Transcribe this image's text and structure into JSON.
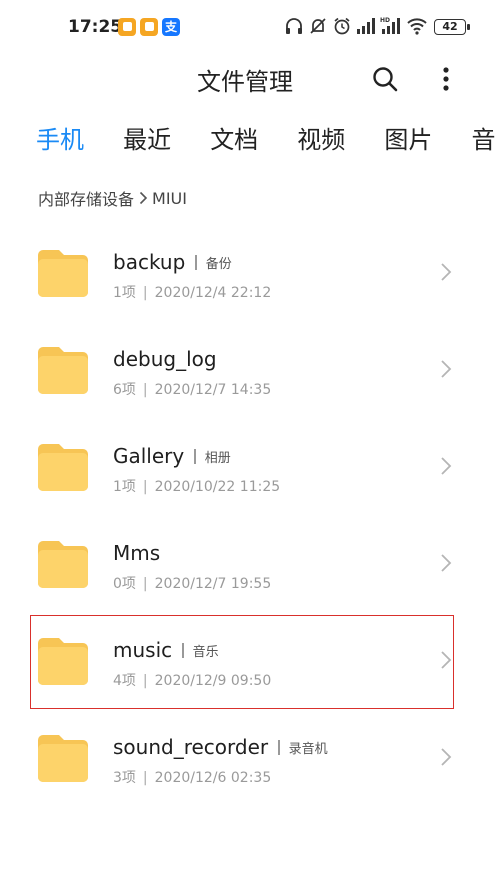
{
  "status_bar": {
    "time": "17:25",
    "notifications": [
      {
        "icon": "orange-app-icon",
        "color": "#f5a623"
      },
      {
        "icon": "orange-app-icon",
        "color": "#f5a623"
      },
      {
        "icon": "alipay-icon",
        "color": "#1677ff",
        "glyph": "支"
      }
    ],
    "battery": "42",
    "icons": [
      "headphones-icon",
      "vibrate-icon",
      "alarm-icon",
      "signal-icon",
      "signal-hd-icon",
      "wifi-icon"
    ]
  },
  "header": {
    "title": "文件管理"
  },
  "tabs": [
    {
      "label": "手机",
      "active": true
    },
    {
      "label": "最近",
      "active": false
    },
    {
      "label": "文档",
      "active": false
    },
    {
      "label": "视频",
      "active": false
    },
    {
      "label": "图片",
      "active": false
    },
    {
      "label": "音",
      "active": false
    }
  ],
  "breadcrumb": {
    "root": "内部存储设备",
    "current": "MIUI"
  },
  "folders": [
    {
      "name": "backup",
      "alias": "备份",
      "count": "1项",
      "date": "2020/12/4 22:12"
    },
    {
      "name": "debug_log",
      "alias": "",
      "count": "6项",
      "date": "2020/12/7 14:35"
    },
    {
      "name": "Gallery",
      "alias": "相册",
      "count": "1项",
      "date": "2020/10/22 11:25"
    },
    {
      "name": "Mms",
      "alias": "",
      "count": "0项",
      "date": "2020/12/7 19:55"
    },
    {
      "name": "music",
      "alias": "音乐",
      "count": "4项",
      "date": "2020/12/9 09:50"
    },
    {
      "name": "sound_recorder",
      "alias": "录音机",
      "count": "3项",
      "date": "2020/12/6 02:35"
    }
  ],
  "colors": {
    "accent": "#1a8af5",
    "folder": "#fdd36a",
    "highlight": "#d9302c"
  }
}
